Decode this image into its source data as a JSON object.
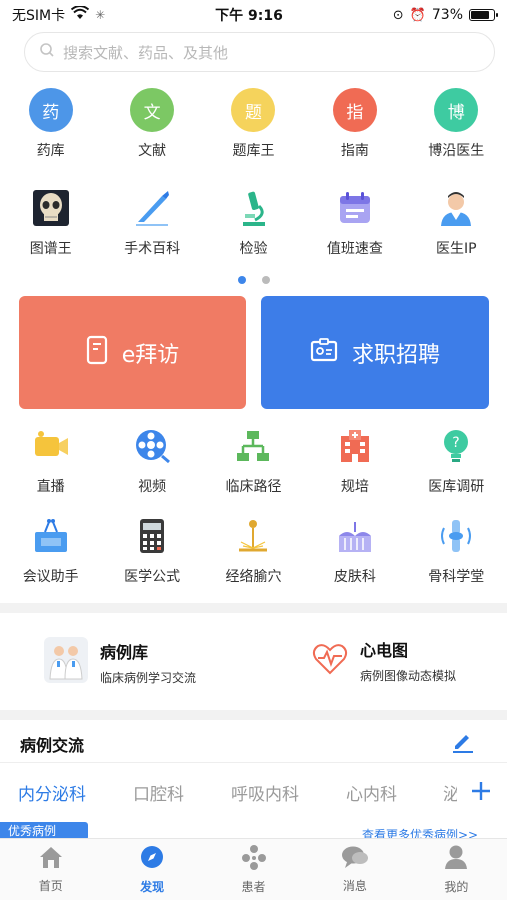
{
  "status": {
    "carrier": "无SIM卡",
    "time": "下午 9:16",
    "battery": "73%",
    "battery_level": 0.73
  },
  "search": {
    "placeholder": "搜索文献、药品、及其他"
  },
  "grid_row1": [
    {
      "label": "药库",
      "glyph": "药",
      "color": "#4d96e8",
      "icon": "drug-icon"
    },
    {
      "label": "文献",
      "glyph": "文",
      "color": "#7cc864",
      "icon": "literature-icon"
    },
    {
      "label": "题库王",
      "glyph": "题",
      "color": "#f5d35c",
      "icon": "quiz-icon"
    },
    {
      "label": "指南",
      "glyph": "指",
      "color": "#f06b54",
      "icon": "guide-icon"
    },
    {
      "label": "博沿医生",
      "glyph": "博",
      "color": "#3ecba1",
      "icon": "boyan-icon"
    }
  ],
  "grid_row2": [
    {
      "label": "图谱王",
      "icon": "skull-atlas-icon"
    },
    {
      "label": "手术百科",
      "icon": "scalpel-icon"
    },
    {
      "label": "检验",
      "icon": "microscope-icon"
    },
    {
      "label": "值班速查",
      "icon": "calendar-icon"
    },
    {
      "label": "医生IP",
      "icon": "doctor-icon"
    }
  ],
  "banners": {
    "left": {
      "label": "e拜访",
      "color": "#f07b64",
      "icon": "phone-icon"
    },
    "right": {
      "label": "求职招聘",
      "color": "#3d7de8",
      "icon": "id-card-icon"
    }
  },
  "grid_row3": [
    {
      "label": "直播",
      "icon": "video-camera-icon"
    },
    {
      "label": "视频",
      "icon": "film-reel-icon"
    },
    {
      "label": "临床路径",
      "icon": "flowchart-icon"
    },
    {
      "label": "规培",
      "icon": "hospital-icon"
    },
    {
      "label": "医库调研",
      "icon": "survey-bulb-icon"
    }
  ],
  "grid_row4": [
    {
      "label": "会议助手",
      "icon": "podium-icon"
    },
    {
      "label": "医学公式",
      "icon": "calculator-icon"
    },
    {
      "label": "经络腧穴",
      "icon": "acupuncture-icon"
    },
    {
      "label": "皮肤科",
      "icon": "skin-icon"
    },
    {
      "label": "骨科学堂",
      "icon": "bone-icon"
    }
  ],
  "features": [
    {
      "title": "病例库",
      "sub": "临床病例学习交流",
      "icon": "doctors-icon"
    },
    {
      "title": "心电图",
      "sub": "病例图像动态模拟",
      "icon": "ecg-heart-icon"
    }
  ],
  "case_section": {
    "title": "病例交流",
    "edit_icon": "edit-icon"
  },
  "tabs": [
    "内分泌科",
    "口腔科",
    "呼吸内科",
    "心内科",
    "泌"
  ],
  "add_icon": "plus-icon",
  "partial": {
    "badge": "优秀病例",
    "more": "查看更多优秀病例>>"
  },
  "nav": [
    {
      "label": "首页",
      "icon": "home-icon"
    },
    {
      "label": "发现",
      "icon": "compass-icon"
    },
    {
      "label": "患者",
      "icon": "patients-icon"
    },
    {
      "label": "消息",
      "icon": "message-icon"
    },
    {
      "label": "我的",
      "icon": "user-icon"
    }
  ],
  "colors": {
    "accent": "#2d7be5"
  }
}
